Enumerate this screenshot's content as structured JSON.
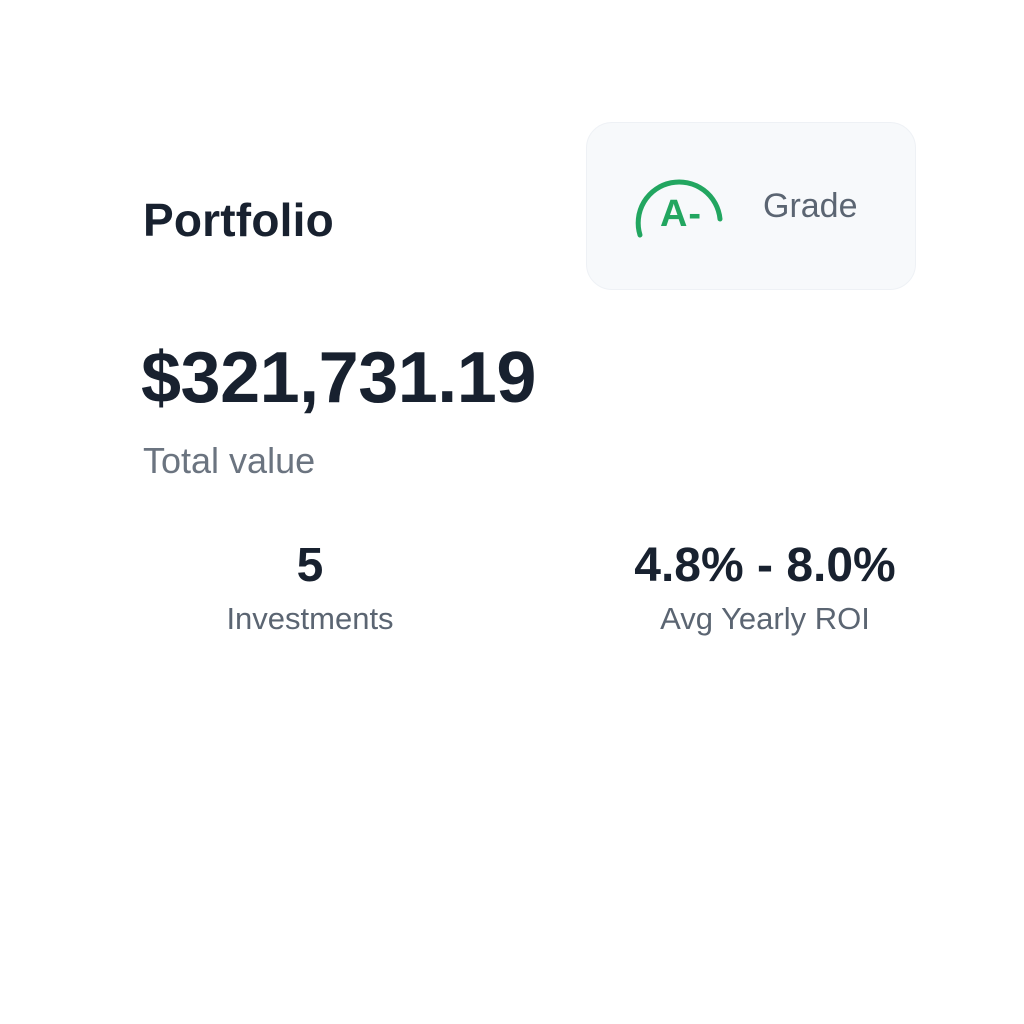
{
  "portfolio": {
    "title": "Portfolio",
    "grade": {
      "value": "A-",
      "label": "Grade",
      "ring_color": "#22a660"
    },
    "total": {
      "value": "$321,731.19",
      "label": "Total value"
    },
    "stats": [
      {
        "value": "5",
        "label": "Investments"
      },
      {
        "value": "4.8% - 8.0%",
        "label": "Avg Yearly ROI"
      }
    ]
  },
  "colors": {
    "text_primary": "#18212f",
    "text_secondary": "#5b6572",
    "accent_green": "#22a660",
    "card_background": "#f7f9fb"
  }
}
